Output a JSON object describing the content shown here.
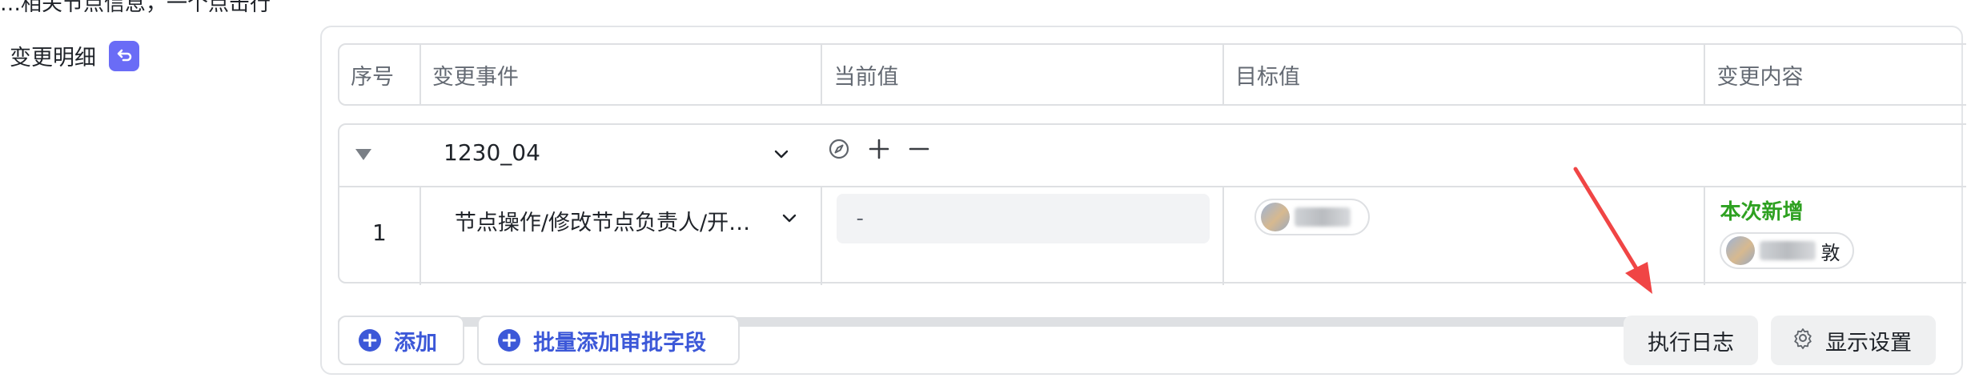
{
  "section": {
    "top_cut_text": "…相关节点信息，一个点击行",
    "label": "变更明细",
    "badge_icon": "loop-icon"
  },
  "table": {
    "headers": [
      "序号",
      "变更事件",
      "当前值",
      "目标值",
      "变更内容"
    ],
    "group": {
      "name": "1230_04",
      "tools": [
        "compass-icon",
        "plus-icon",
        "minus-icon"
      ]
    },
    "rows": [
      {
        "index": "1",
        "event": "节点操作/修改节点负责人/开…",
        "current": "-",
        "target_chip_suffix": "",
        "change_label": "本次新增",
        "change_chip_suffix": "敦"
      }
    ]
  },
  "actions": {
    "add_label": "添加",
    "batch_add_label": "批量添加审批字段",
    "log_label": "执行日志",
    "display_settings_label": "显示设置"
  },
  "colors": {
    "accent": "#3c58d8",
    "badge": "#6a6cf6",
    "new": "#2ea121",
    "arrow": "#f04545"
  }
}
